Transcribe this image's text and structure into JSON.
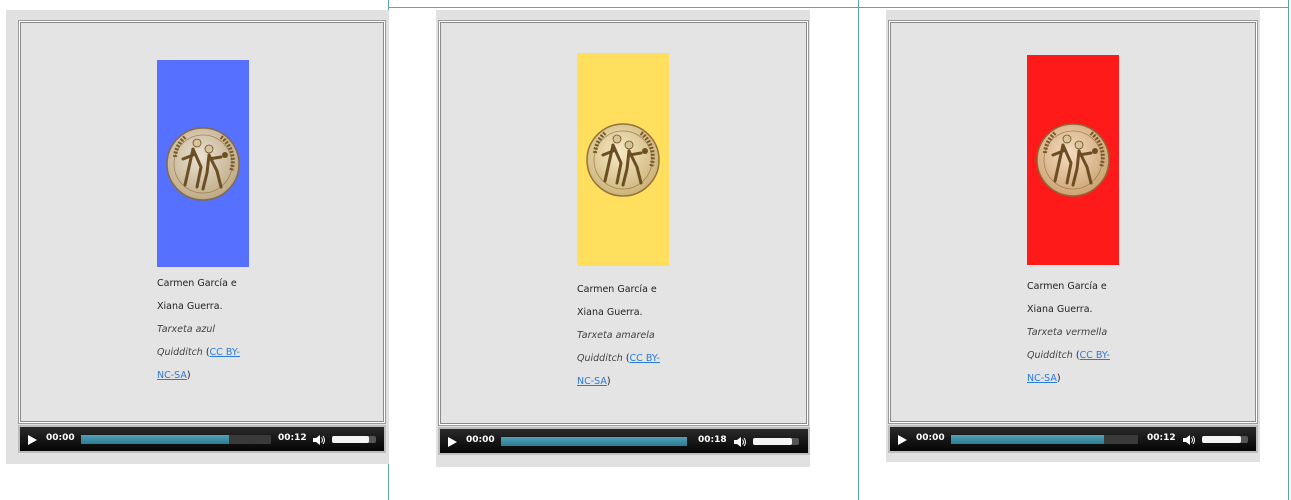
{
  "players": [
    {
      "card_color": "#5670ff",
      "logo_icon": "quidditch-emblem-icon",
      "caption": {
        "line1": "Carmen García e",
        "line2": "Xiana Guerra.",
        "title1": "Tarxeta azul",
        "title2": "Quidditch",
        "link1": "CC BY-",
        "link2": "NC-SA",
        "close": ")",
        "open": " ("
      },
      "current_time": "00:00",
      "duration": "00:12",
      "progress_fraction": 0.78,
      "volume_fraction": 0.85
    },
    {
      "card_color": "#ffdf5d",
      "logo_icon": "quidditch-emblem-icon",
      "caption": {
        "line1": "Carmen García e",
        "line2": "Xiana Guerra.",
        "title1": "Tarxeta amarela",
        "title2": "Quidditch",
        "link1": "CC BY-",
        "link2": "NC-SA",
        "close": ")",
        "open": " ("
      },
      "current_time": "00:00",
      "duration": "00:18",
      "progress_fraction": 1.0,
      "volume_fraction": 0.85
    },
    {
      "card_color": "#ff1a1a",
      "logo_icon": "quidditch-emblem-icon",
      "caption": {
        "line1": "Carmen García e",
        "line2": "Xiana Guerra.",
        "title1": "Tarxeta vermella",
        "title2": "Quidditch",
        "link1": "CC BY-",
        "link2": "NC-SA",
        "close": ")",
        "open": " ("
      },
      "current_time": "00:00",
      "duration": "00:12",
      "progress_fraction": 0.82,
      "volume_fraction": 0.85
    }
  ]
}
